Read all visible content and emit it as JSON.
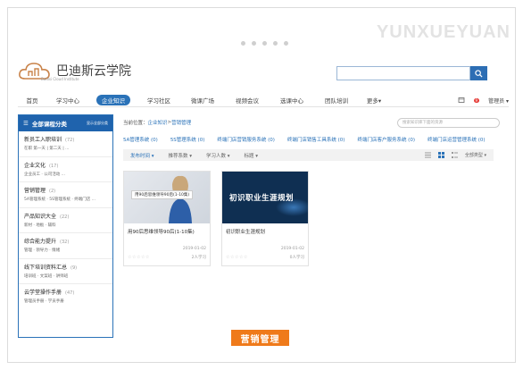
{
  "watermark": "YUNXUEYUAN",
  "logo": {
    "title": "巴迪斯云学院",
    "subtitle": "Badisi Cloud Institute"
  },
  "nav": {
    "items": [
      "首页",
      "学习中心",
      "企业知识",
      "学习社区",
      "微课广场",
      "视频会议",
      "选课中心",
      "团队培训",
      "更多"
    ],
    "active_index": 2,
    "more_arrow": "▾",
    "badge_count": "9",
    "user": "管理员 ▾"
  },
  "sidebar": {
    "title": "全部课程分类",
    "all_label": "显示全部分类",
    "categories": [
      {
        "name": "新员工入职培训",
        "count": "(72)",
        "sub": "在职  第一天 | 第二天 | ..."
      },
      {
        "name": "企业文化",
        "count": "(17)",
        "sub": "企业员工 · 公司活动 ..."
      },
      {
        "name": "营销管理",
        "count": "(2)",
        "sub": "5A管理系统 · 5S管理系统 · 终端门店 ..."
      },
      {
        "name": "产品知识大全",
        "count": "(22)",
        "sub": "新材 · 地板 · 辅料"
      },
      {
        "name": "综合能力提升",
        "count": "(32)",
        "sub": "管理 · 领导力 · 情绪"
      },
      {
        "name": "线下培训资料汇总",
        "count": "(9)",
        "sub": "培训班 · 文案班 · 讲师班"
      },
      {
        "name": "云学堂操作手册",
        "count": "(47)",
        "sub": "管理员手册 · 学员手册"
      }
    ]
  },
  "main": {
    "crumb_prefix": "当前位置：",
    "crumb_link": "企业知识",
    "crumb_sep": " > ",
    "crumb_current": "营销管理",
    "search_placeholder": "搜索知识库下面的资源",
    "tags": [
      "5A管理系统 (0)",
      "5S管理系统 (0)",
      "终端门店营销服务系统 (0)",
      "终端门店销售工具系统 (0)",
      "终端门店客户服务系统 (0)",
      "终端门店运营管理系统 (0)"
    ],
    "sort": [
      "发布时间 ▾",
      "推荐系数 ▾",
      "学习人数 ▾",
      "标题 ▾"
    ],
    "category_select": "全部类型 ▾",
    "courses": [
      {
        "thumb_label": "用90后思维领导90后(1-10集)",
        "title": "用90后思维领导90后(1-10集)",
        "date": "2019-01-02",
        "learners": "2人学习",
        "stars": "☆☆☆☆☆"
      },
      {
        "thumb_label": "初识职业生涯规划",
        "title": "初识职业生涯规划",
        "date": "2019-01-02",
        "learners": "0人学习",
        "stars": "☆☆☆☆☆"
      }
    ]
  },
  "caption": "营销管理",
  "colors": {
    "primary": "#2a72b8",
    "accent": "#ef7a1a"
  }
}
